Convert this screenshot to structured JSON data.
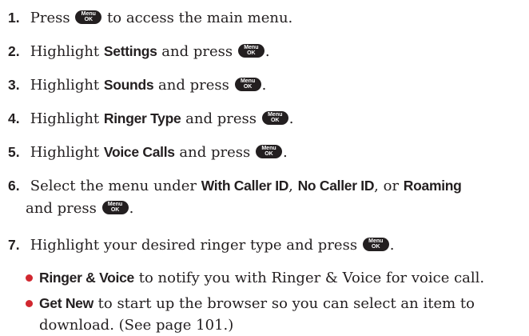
{
  "key_label_top": "Menu",
  "key_label_bottom": "OK",
  "accent_color": "#d1272f",
  "steps": [
    {
      "num": "1.",
      "a": "Press",
      "b": "to access the main menu."
    },
    {
      "num": "2.",
      "a": "Highlight",
      "term": "Settings",
      "b": "and press",
      "end": "."
    },
    {
      "num": "3.",
      "a": "Highlight",
      "term": "Sounds",
      "b": "and press",
      "end": "."
    },
    {
      "num": "4.",
      "a": "Highlight",
      "term": "Ringer Type",
      "b": "and press",
      "end": "."
    },
    {
      "num": "5.",
      "a": "Highlight",
      "term": "Voice Calls",
      "b": "and press",
      "end": "."
    },
    {
      "num": "6.",
      "a": "Select the menu under",
      "term1": "With Caller ID",
      "sep1": ",",
      "term2": "No Caller ID",
      "sep2": ", or",
      "term3": "Roaming",
      "line2a": "and press",
      "end": "."
    },
    {
      "num": "7.",
      "a": "Highlight your desired ringer type and press",
      "end": "."
    }
  ],
  "bullets": [
    {
      "term": "Ringer & Voice",
      "text": "to notify you with Ringer & Voice for voice call."
    },
    {
      "term": "Get New",
      "text": "to start up the browser so you can select an item to",
      "text2": "download. (See page 101.)"
    }
  ]
}
